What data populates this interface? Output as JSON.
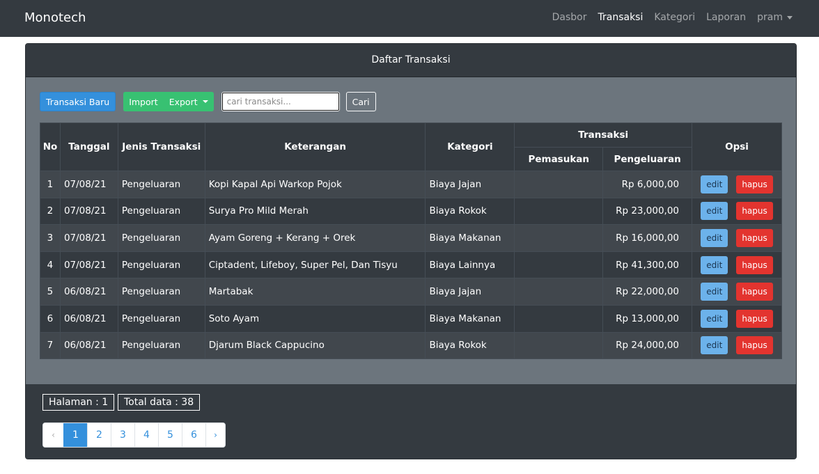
{
  "navbar": {
    "brand": "Monotech",
    "links": [
      "Dasbor",
      "Transaksi",
      "Kategori",
      "Laporan"
    ],
    "user": "pram"
  },
  "card": {
    "title": "Daftar Transaksi"
  },
  "toolbar": {
    "new_label": "Transaksi Baru",
    "import_label": "Import",
    "export_label": "Export",
    "search_placeholder": "cari transaksi...",
    "search_button": "Cari"
  },
  "table": {
    "headers": {
      "no": "No",
      "date": "Tanggal",
      "type": "Jenis Transaksi",
      "desc": "Keterangan",
      "category": "Kategori",
      "transaction": "Transaksi",
      "income": "Pemasukan",
      "expense": "Pengeluaran",
      "options": "Opsi"
    },
    "rows": [
      {
        "no": "1",
        "date": "07/08/21",
        "type": "Pengeluaran",
        "desc": "Kopi Kapal Api Warkop Pojok",
        "category": "Biaya Jajan",
        "income": "",
        "expense": "Rp 6,000,00"
      },
      {
        "no": "2",
        "date": "07/08/21",
        "type": "Pengeluaran",
        "desc": "Surya Pro Mild Merah",
        "category": "Biaya Rokok",
        "income": "",
        "expense": "Rp 23,000,00"
      },
      {
        "no": "3",
        "date": "07/08/21",
        "type": "Pengeluaran",
        "desc": "Ayam Goreng + Kerang + Orek",
        "category": "Biaya Makanan",
        "income": "",
        "expense": "Rp 16,000,00"
      },
      {
        "no": "4",
        "date": "07/08/21",
        "type": "Pengeluaran",
        "desc": "Ciptadent, Lifeboy, Super Pel, Dan Tisyu",
        "category": "Biaya Lainnya",
        "income": "",
        "expense": "Rp 41,300,00"
      },
      {
        "no": "5",
        "date": "06/08/21",
        "type": "Pengeluaran",
        "desc": "Martabak",
        "category": "Biaya Jajan",
        "income": "",
        "expense": "Rp 22,000,00"
      },
      {
        "no": "6",
        "date": "06/08/21",
        "type": "Pengeluaran",
        "desc": "Soto Ayam",
        "category": "Biaya Makanan",
        "income": "",
        "expense": "Rp 13,000,00"
      },
      {
        "no": "7",
        "date": "06/08/21",
        "type": "Pengeluaran",
        "desc": "Djarum Black Cappucino",
        "category": "Biaya Rokok",
        "income": "",
        "expense": "Rp 24,000,00"
      }
    ],
    "edit_label": "edit",
    "delete_label": "hapus"
  },
  "footer": {
    "page_info": "Halaman : 1",
    "total_info": "Total data : 38",
    "prev": "‹",
    "next": "›",
    "pages": [
      "1",
      "2",
      "3",
      "4",
      "5",
      "6"
    ],
    "active_page": "1"
  }
}
